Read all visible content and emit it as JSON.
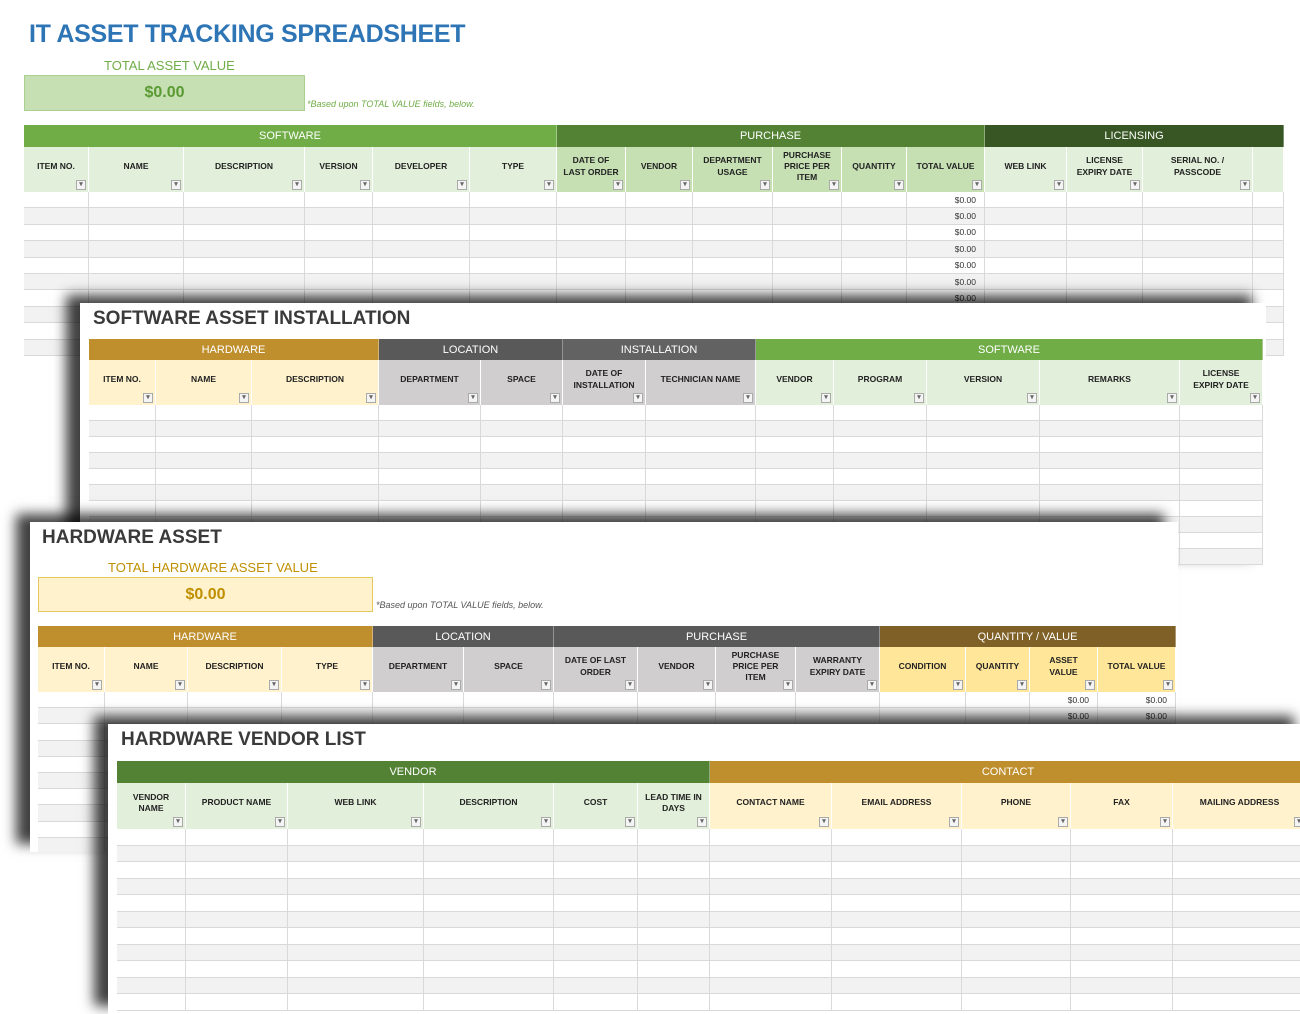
{
  "main": {
    "title": "IT ASSET TRACKING SPREADSHEET",
    "total_label": "TOTAL ASSET VALUE",
    "total_value": "$0.00",
    "note": "*Based upon TOTAL VALUE fields, below."
  },
  "hardware": {
    "title": "HARDWARE ASSET",
    "total_label": "TOTAL HARDWARE ASSET VALUE",
    "total_value": "$0.00",
    "note": "*Based upon TOTAL VALUE fields, below."
  },
  "installation": {
    "title": "SOFTWARE ASSET INSTALLATION"
  },
  "vendor": {
    "title": "HARDWARE VENDOR LIST"
  },
  "colors": {
    "title_blue": "#2e75b6",
    "green": "#70ad47",
    "dark_green": "#548235",
    "darkest_green": "#375623",
    "gold": "#bf8f2e",
    "gray": "#595959",
    "brown": "#7f6027"
  },
  "tables": {
    "t1": {
      "groups": [
        {
          "label": "SOFTWARE",
          "color": "#70ad47"
        },
        {
          "label": "PURCHASE",
          "color": "#548235"
        },
        {
          "label": "LICENSING",
          "color": "#375623"
        }
      ],
      "columns": [
        {
          "label": "ITEM NO.",
          "g": 0
        },
        {
          "label": "NAME",
          "g": 0
        },
        {
          "label": "DESCRIPTION",
          "g": 0
        },
        {
          "label": "VERSION",
          "g": 0
        },
        {
          "label": "DEVELOPER",
          "g": 0
        },
        {
          "label": "TYPE",
          "g": 0
        },
        {
          "label": "DATE OF LAST ORDER",
          "g": 1
        },
        {
          "label": "VENDOR",
          "g": 1
        },
        {
          "label": "DEPARTMENT USAGE",
          "g": 1
        },
        {
          "label": "PURCHASE PRICE PER ITEM",
          "g": 1
        },
        {
          "label": "QUANTITY",
          "g": 1
        },
        {
          "label": "TOTAL VALUE",
          "g": 1
        },
        {
          "label": "WEB LINK",
          "g": 2
        },
        {
          "label": "LICENSE EXPIRY DATE",
          "g": 2
        },
        {
          "label": "SERIAL NO. / PASSCODE",
          "g": 2
        },
        {
          "label": "",
          "g": 2
        }
      ],
      "row_count": 10,
      "column_values": {
        "11": [
          "$0.00",
          "$0.00",
          "$0.00",
          "$0.00",
          "$0.00",
          "$0.00",
          "$0.00"
        ]
      }
    },
    "t2": {
      "groups": [
        {
          "label": "HARDWARE",
          "color": "#bf8f2e"
        },
        {
          "label": "LOCATION",
          "color": "#595959"
        },
        {
          "label": "INSTALLATION",
          "color": "#626262"
        },
        {
          "label": "SOFTWARE",
          "color": "#70ad47"
        }
      ],
      "columns": [
        {
          "label": "ITEM NO.",
          "g": 0
        },
        {
          "label": "NAME",
          "g": 0
        },
        {
          "label": "DESCRIPTION",
          "g": 0
        },
        {
          "label": "DEPARTMENT",
          "g": 1
        },
        {
          "label": "SPACE",
          "g": 1
        },
        {
          "label": "DATE OF INSTALLATION",
          "g": 2
        },
        {
          "label": "TECHNICIAN NAME",
          "g": 2
        },
        {
          "label": "VENDOR",
          "g": 3
        },
        {
          "label": "PROGRAM",
          "g": 3
        },
        {
          "label": "VERSION",
          "g": 3
        },
        {
          "label": "REMARKS",
          "g": 3
        },
        {
          "label": "LICENSE EXPIRY DATE",
          "g": 3
        }
      ],
      "row_count": 10,
      "column_values": {}
    },
    "t3": {
      "groups": [
        {
          "label": "HARDWARE",
          "color": "#bf8f2e"
        },
        {
          "label": "LOCATION",
          "color": "#595959"
        },
        {
          "label": "PURCHASE",
          "color": "#595959"
        },
        {
          "label": "QUANTITY / VALUE",
          "color": "#7f6027"
        }
      ],
      "columns": [
        {
          "label": "ITEM NO.",
          "g": 0
        },
        {
          "label": "NAME",
          "g": 0
        },
        {
          "label": "DESCRIPTION",
          "g": 0
        },
        {
          "label": "TYPE",
          "g": 0
        },
        {
          "label": "DEPARTMENT",
          "g": 1
        },
        {
          "label": "SPACE",
          "g": 1
        },
        {
          "label": "DATE OF LAST ORDER",
          "g": 2
        },
        {
          "label": "VENDOR",
          "g": 2
        },
        {
          "label": "PURCHASE PRICE PER ITEM",
          "g": 2
        },
        {
          "label": "WARRANTY EXPIRY DATE",
          "g": 2
        },
        {
          "label": "CONDITION",
          "g": 3
        },
        {
          "label": "QUANTITY",
          "g": 3
        },
        {
          "label": "ASSET VALUE",
          "g": 3
        },
        {
          "label": "TOTAL VALUE",
          "g": 3
        }
      ],
      "row_count": 10,
      "column_values": {
        "12": [
          "$0.00",
          "$0.00"
        ],
        "13": [
          "$0.00",
          "$0.00"
        ]
      }
    },
    "t4": {
      "groups": [
        {
          "label": "VENDOR",
          "color": "#548235"
        },
        {
          "label": "CONTACT",
          "color": "#bf8f2e"
        }
      ],
      "columns": [
        {
          "label": "VENDOR NAME",
          "g": 0
        },
        {
          "label": "PRODUCT NAME",
          "g": 0
        },
        {
          "label": "WEB LINK",
          "g": 0
        },
        {
          "label": "DESCRIPTION",
          "g": 0
        },
        {
          "label": "COST",
          "g": 0
        },
        {
          "label": "LEAD TIME IN DAYS",
          "g": 0
        },
        {
          "label": "CONTACT NAME",
          "g": 1
        },
        {
          "label": "EMAIL ADDRESS",
          "g": 1
        },
        {
          "label": "PHONE",
          "g": 1
        },
        {
          "label": "FAX",
          "g": 1
        },
        {
          "label": "MAILING ADDRESS",
          "g": 1
        }
      ],
      "row_count": 11,
      "column_values": {}
    }
  }
}
